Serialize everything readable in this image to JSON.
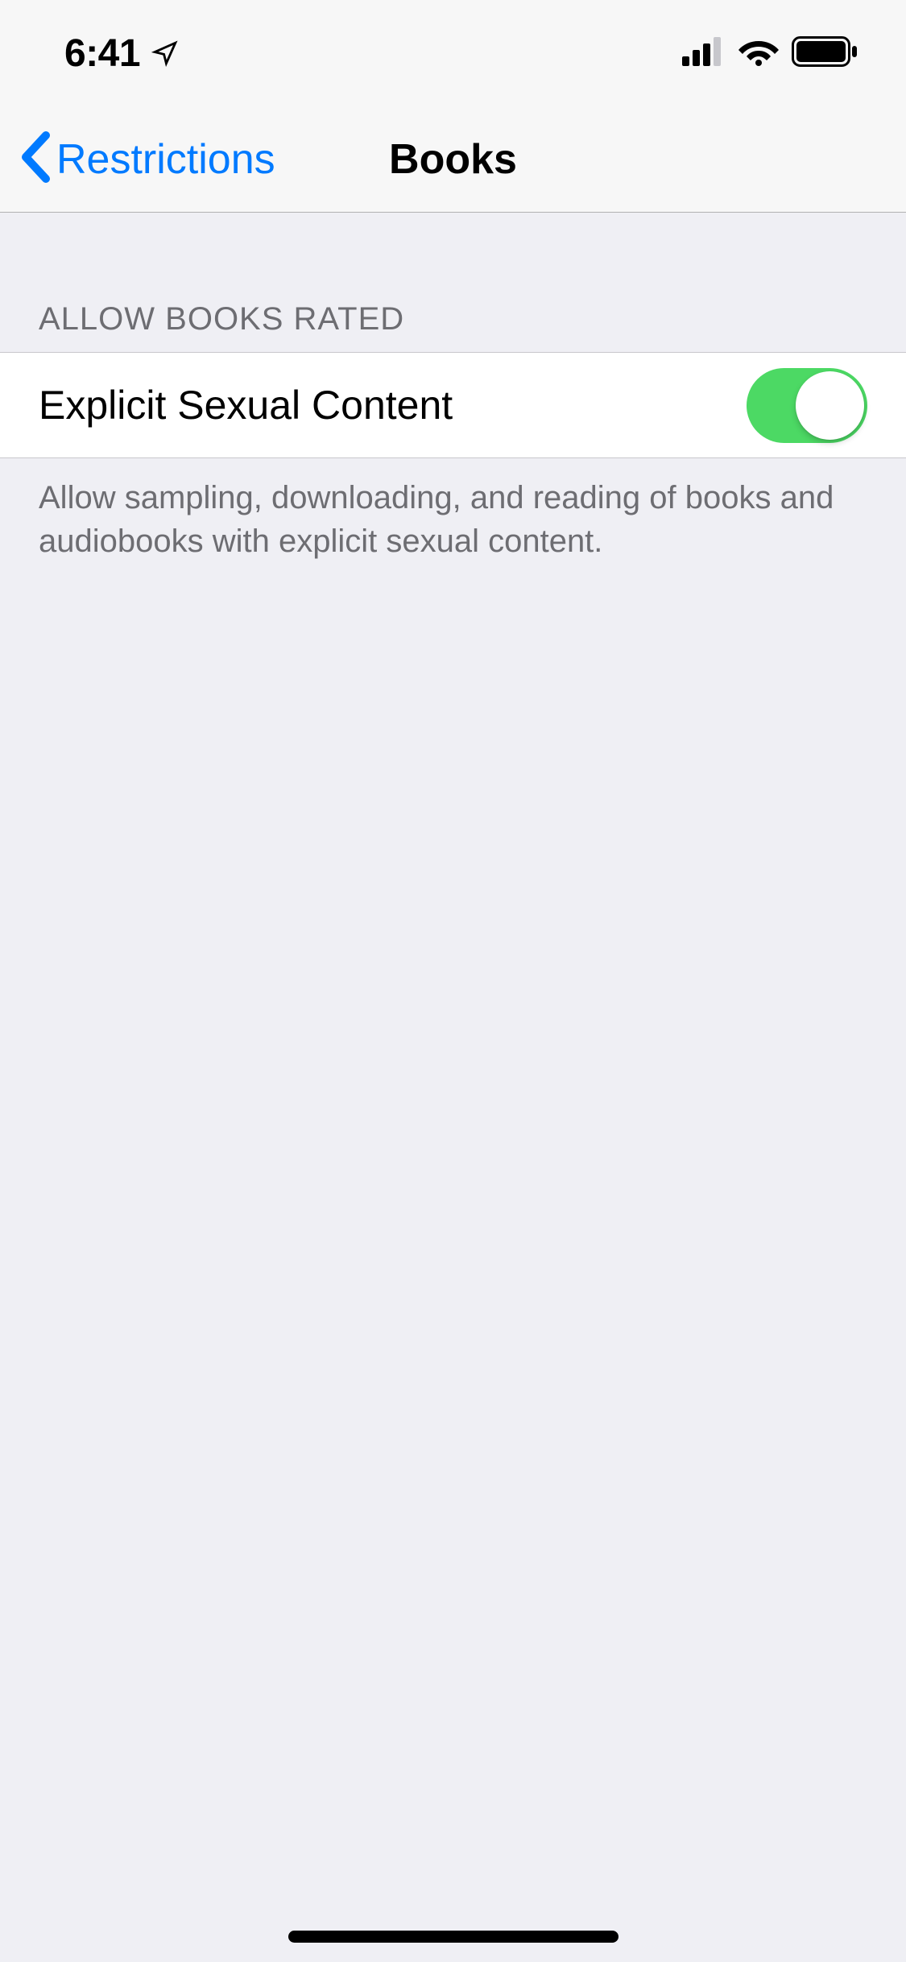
{
  "statusBar": {
    "time": "6:41"
  },
  "nav": {
    "backLabel": "Restrictions",
    "title": "Books"
  },
  "section": {
    "header": "ALLOW BOOKS RATED",
    "rowLabel": "Explicit Sexual Content",
    "toggleOn": true,
    "footer": "Allow sampling, downloading, and reading of books and audiobooks with explicit sexual content."
  },
  "colors": {
    "accent": "#007aff",
    "toggleOn": "#4cd964",
    "background": "#efeff4"
  }
}
